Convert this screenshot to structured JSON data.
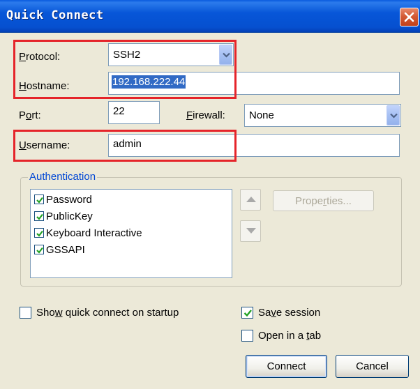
{
  "window": {
    "title": "Quick Connect"
  },
  "form": {
    "protocol": {
      "label": "Protocol:",
      "value": "SSH2"
    },
    "hostname": {
      "label": "Hostname:",
      "value": "192.168.222.44"
    },
    "port": {
      "label": "Port:",
      "value": "22"
    },
    "firewall": {
      "label": "Firewall:",
      "value": "None"
    },
    "username": {
      "label": "Username:",
      "value": "admin"
    }
  },
  "authentication": {
    "legend": "Authentication",
    "methods": [
      {
        "label": "Password",
        "checked": true
      },
      {
        "label": "PublicKey",
        "checked": true
      },
      {
        "label": "Keyboard Interactive",
        "checked": true
      },
      {
        "label": "GSSAPI",
        "checked": true
      }
    ],
    "properties_label": "Properties..."
  },
  "options": {
    "show_on_startup": {
      "label": "Show quick connect on startup",
      "checked": false
    },
    "save_session": {
      "label": "Save session",
      "checked": true
    },
    "open_in_tab": {
      "label": "Open in a tab",
      "checked": false
    }
  },
  "buttons": {
    "connect": "Connect",
    "cancel": "Cancel"
  },
  "colors": {
    "titlebar": "#0756D8",
    "dialog_bg": "#ECE9D8",
    "highlight": "#E5242A",
    "selection": "#316AC5",
    "checkmark": "#21A121"
  }
}
